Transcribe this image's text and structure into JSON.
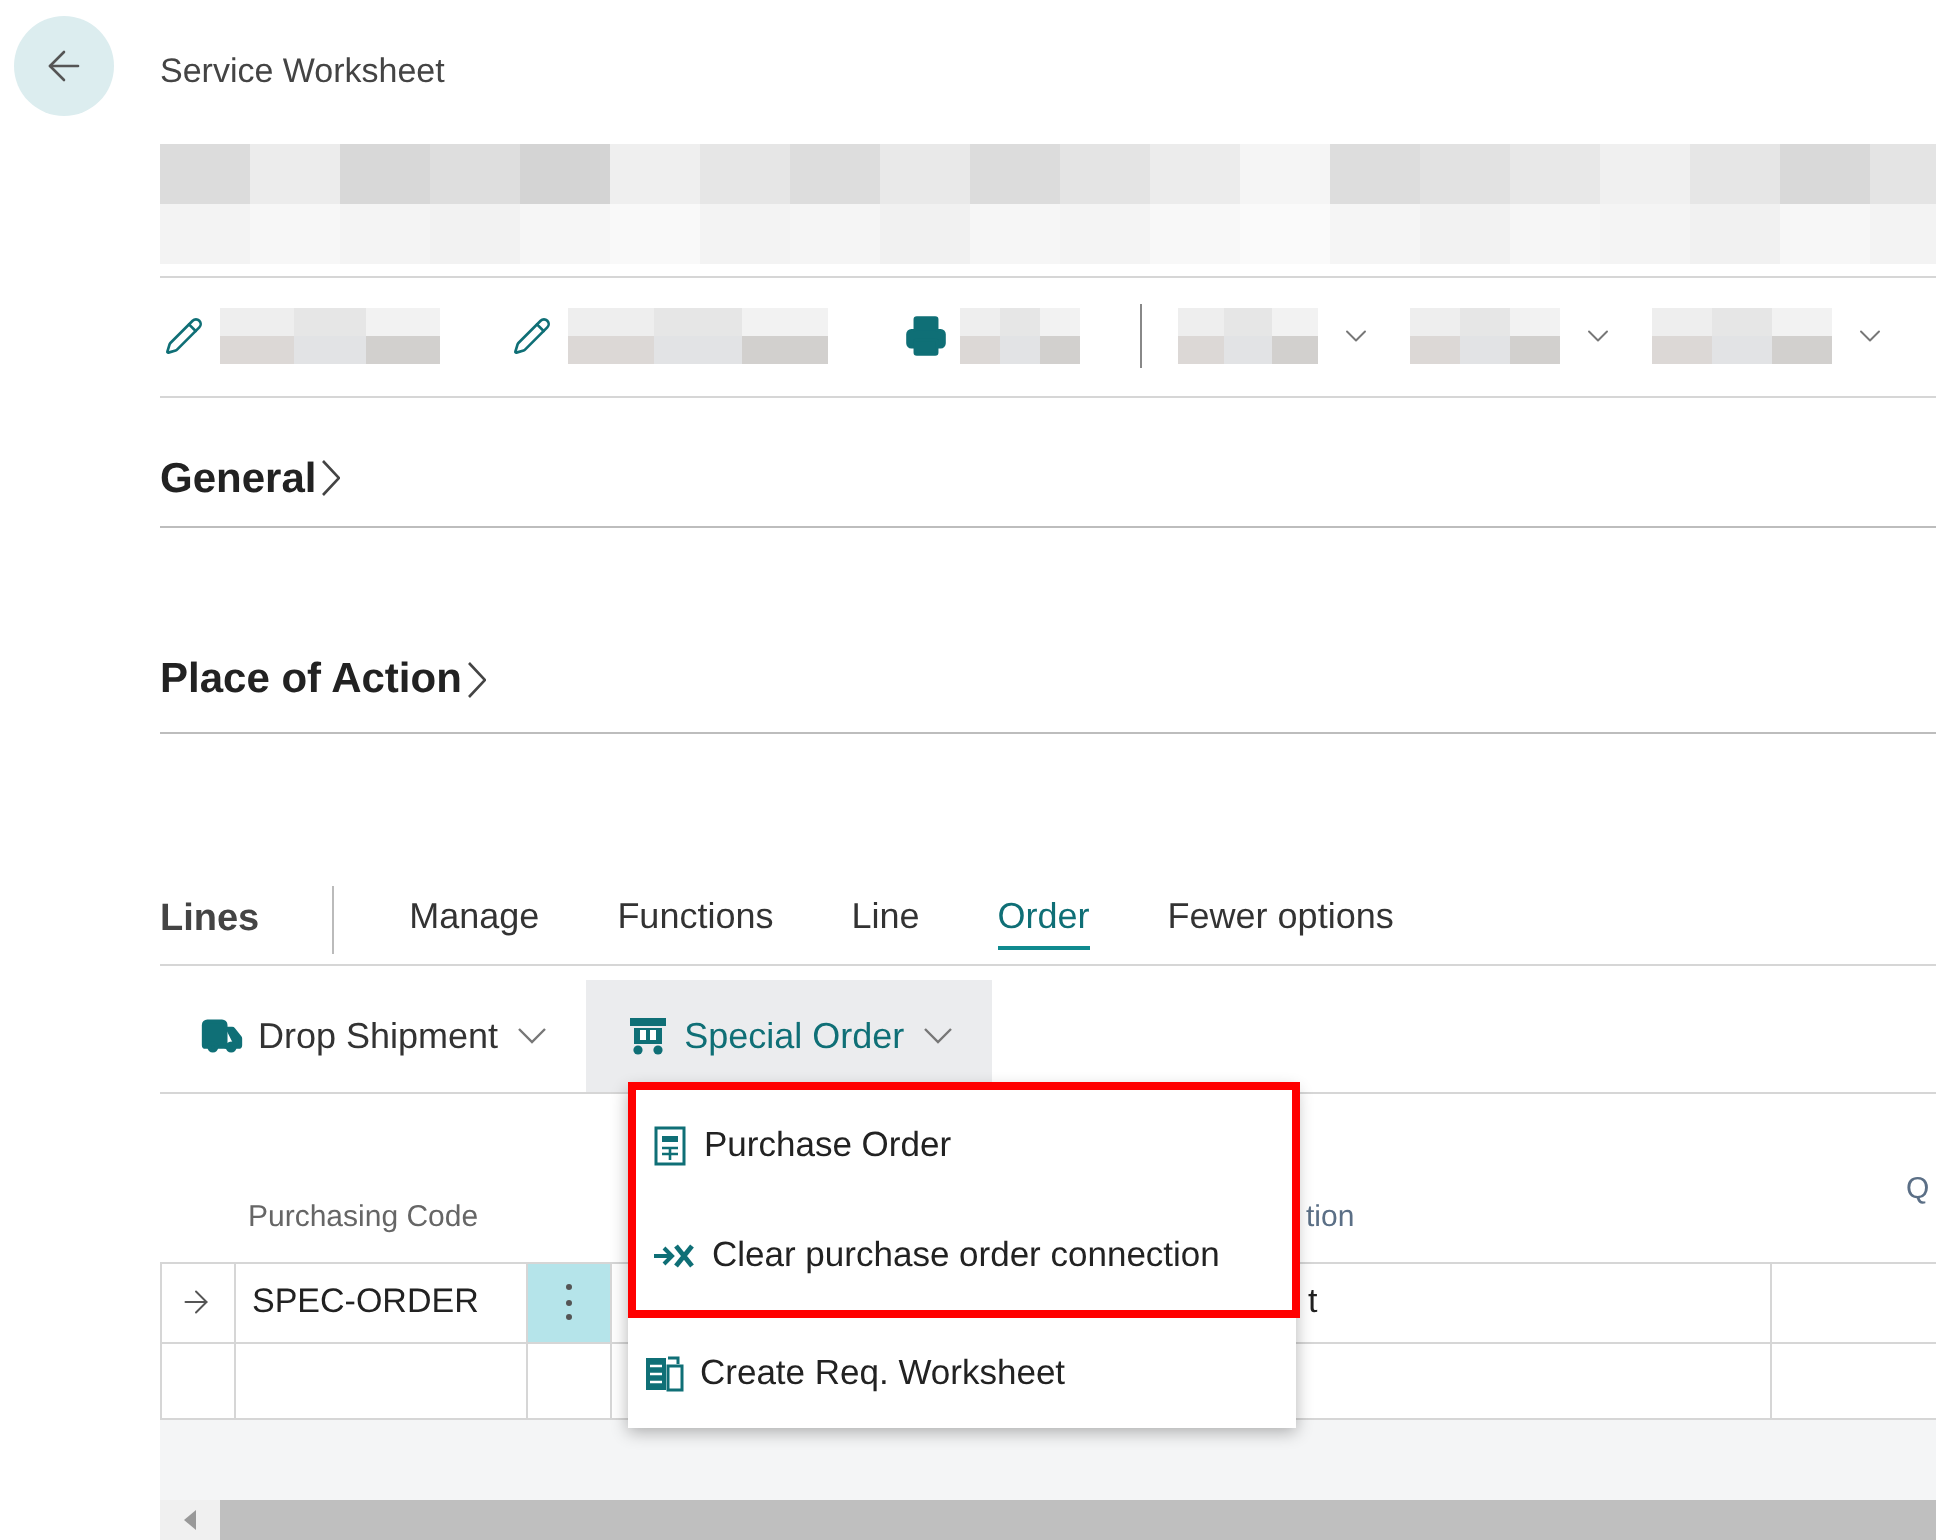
{
  "page": {
    "title": "Service Worksheet"
  },
  "sections": [
    {
      "title": "General",
      "expanded": false
    },
    {
      "title": "Place of Action",
      "expanded": false
    }
  ],
  "lines": {
    "title": "Lines",
    "tabs": [
      {
        "label": "Manage",
        "selected": false
      },
      {
        "label": "Functions",
        "selected": false
      },
      {
        "label": "Line",
        "selected": false
      },
      {
        "label": "Order",
        "selected": true
      },
      {
        "label": "Fewer options",
        "selected": false
      }
    ],
    "actions": [
      {
        "label": "Drop Shipment",
        "kind": "truck",
        "open": false
      },
      {
        "label": "Special Order",
        "kind": "special",
        "open": true
      }
    ],
    "menu": [
      {
        "label": "Purchase Order",
        "kind": "document",
        "highlighted": true
      },
      {
        "label": "Clear purchase order connection",
        "kind": "clear",
        "highlighted": true
      },
      {
        "label": "Create Req. Worksheet",
        "kind": "worksheet",
        "highlighted": false
      }
    ],
    "table": {
      "columns": [
        {
          "label": "Purchasing Code"
        },
        {
          "label": "tion"
        },
        {
          "label": "Q"
        }
      ],
      "rows": [
        {
          "selected": true,
          "purchasing_code": "SPEC-ORDER",
          "description": "t"
        },
        {
          "selected": false
        }
      ]
    }
  }
}
